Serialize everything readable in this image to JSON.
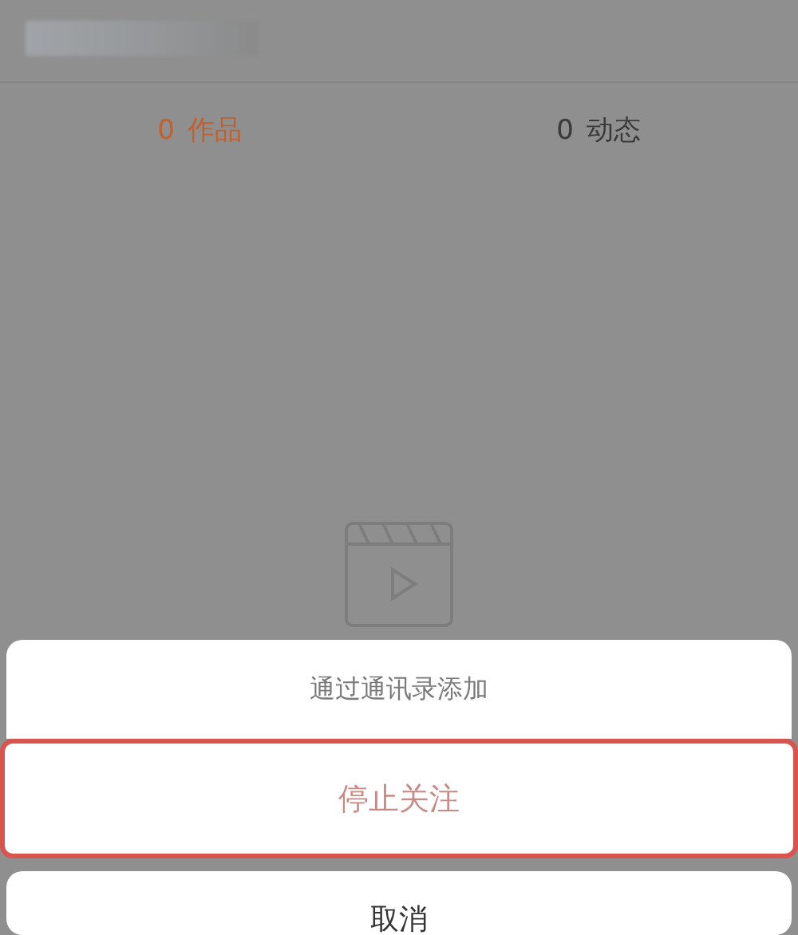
{
  "profile": {
    "name_blurred": true
  },
  "tabs": [
    {
      "count": "0",
      "label": "作品",
      "selected": true
    },
    {
      "count": "0",
      "label": "动态",
      "selected": false
    }
  ],
  "action_sheet": {
    "items": [
      {
        "label": "通过通讯录添加",
        "kind": "normal",
        "highlighted": false
      },
      {
        "label": "停止关注",
        "kind": "destructive",
        "highlighted": true
      }
    ],
    "cancel": "取消"
  }
}
